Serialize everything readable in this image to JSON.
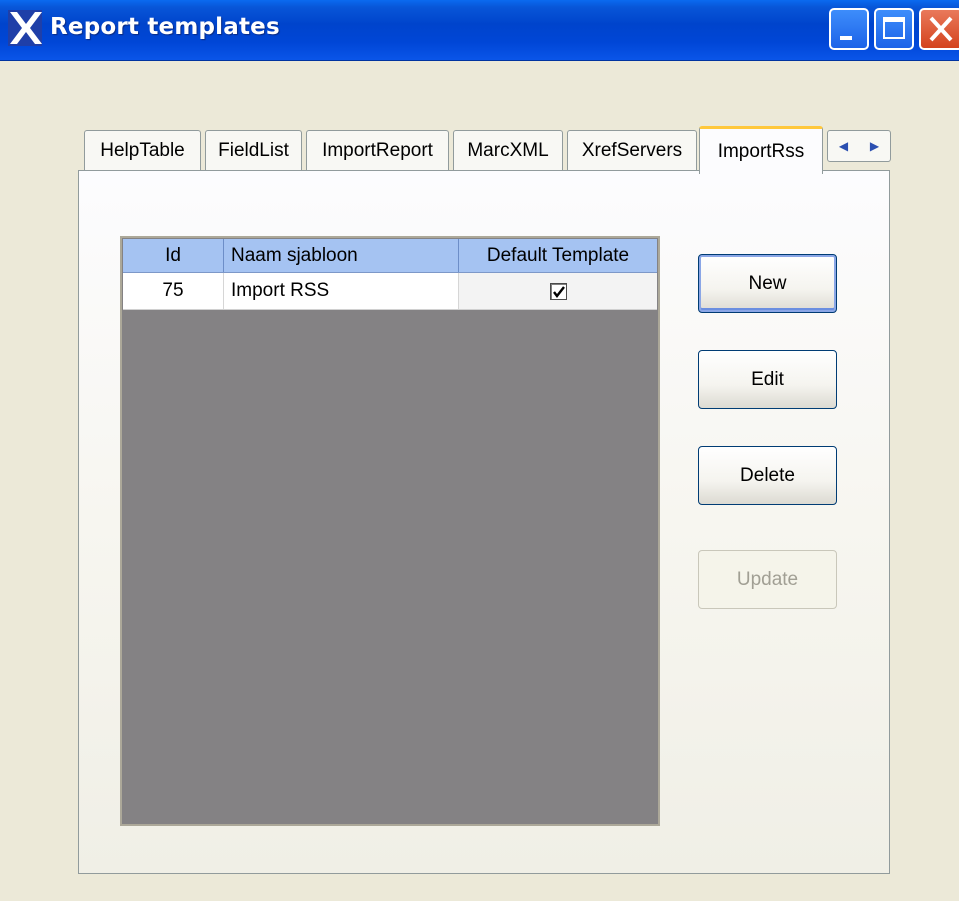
{
  "window": {
    "title": "Report templates",
    "controls": {
      "minimize": "minimize",
      "maximize": "maximize",
      "close": "close"
    }
  },
  "tabs": [
    {
      "label": "HelpTable"
    },
    {
      "label": "FieldList"
    },
    {
      "label": "ImportReport"
    },
    {
      "label": "MarcXML"
    },
    {
      "label": "XrefServers"
    },
    {
      "label": "ImportRss",
      "active": true
    }
  ],
  "grid": {
    "columns": [
      "Id",
      "Naam sjabloon",
      "Default Template"
    ],
    "rows": [
      {
        "id": "75",
        "name": "Import RSS",
        "default_template": true
      }
    ]
  },
  "buttons": {
    "new": "New",
    "edit": "Edit",
    "delete": "Delete",
    "update": "Update"
  },
  "icons": {
    "app": "app-x-icon",
    "tab_scroll_left": "arrow-left-icon",
    "tab_scroll_right": "arrow-right-icon",
    "check": "check-icon"
  },
  "colors": {
    "titlebar": "#0044cc",
    "grid_header": "#a5c3f2",
    "grid_empty": "#848284",
    "active_tab_accent": "#ffc83c"
  }
}
